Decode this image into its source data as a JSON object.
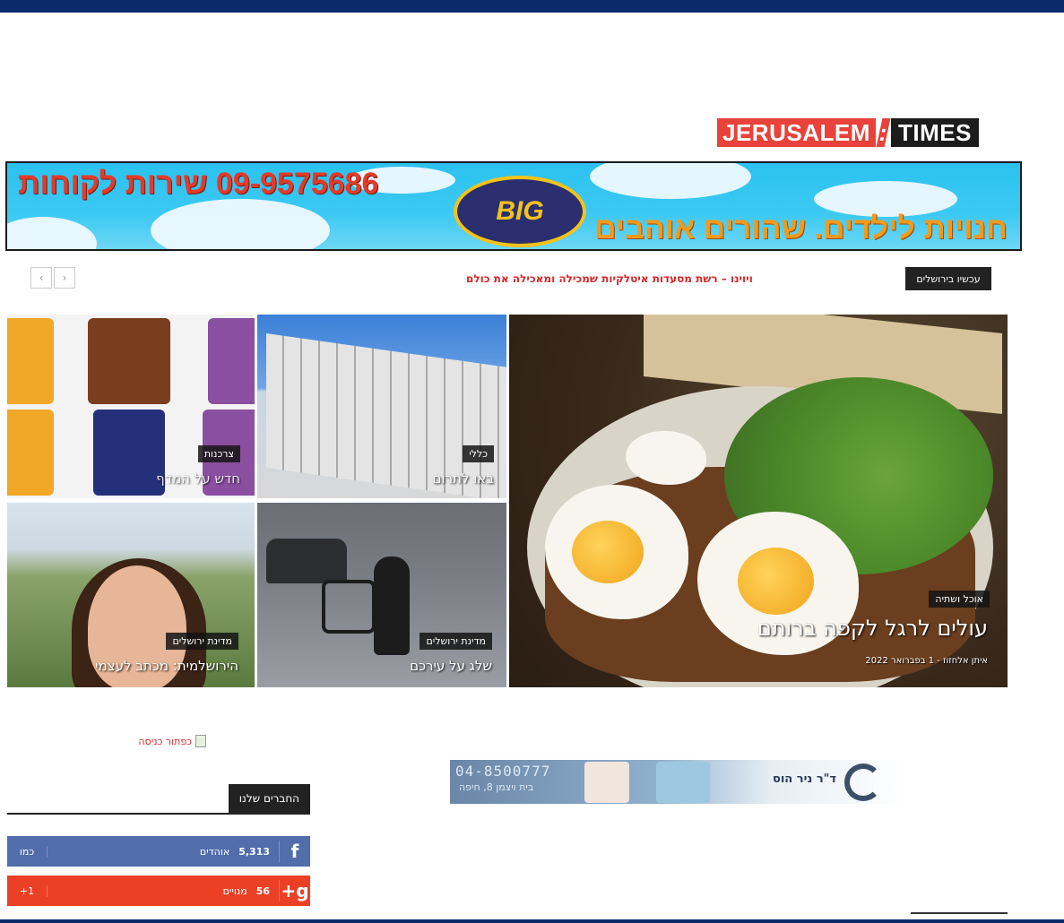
{
  "logo": {
    "part1": "JERUSALEM",
    "separator": ":",
    "part2": "TIMES"
  },
  "banner": {
    "phone_text": "09-9575686 שירות לקוחות",
    "slogan": "חנויות לילדים. שהורים אוהבים",
    "brand": "BIG"
  },
  "ticker": {
    "label": "עכשיו בירושלים",
    "headline": "ויוינו – רשת מסעדות איטלקיות שמכילה ומאכילה את כולם",
    "prev_icon": "chevron-left-icon",
    "next_icon": "chevron-right-icon"
  },
  "tiles": {
    "featured": {
      "category": "אוכל ושתיה",
      "title": "עולים לרגל לקפה ברותם",
      "meta": "איתן אלחזוז - 1 בפברואר 2022"
    },
    "building": {
      "category": "כללי",
      "title": "באו לתרום"
    },
    "snacks": {
      "category": "צרכנות",
      "title": "חדש על המדף"
    },
    "snow": {
      "category": "מדינת ירושלים",
      "title": "שלג על עירכם"
    },
    "woman": {
      "category": "מדינת ירושלים",
      "title": "הירושלמית: מכתב לעצמי"
    }
  },
  "image_placeholder": {
    "alt": "כפתור כניסה"
  },
  "ad_doctor": {
    "phone": "04-8500777",
    "address": "בית ויצמן 8, חיפה",
    "name": "ד\"ר ניר הוס"
  },
  "friends": {
    "title": "החברים שלנו"
  },
  "social": {
    "facebook": {
      "icon": "f",
      "count": "5,313",
      "unit": "אוהדים",
      "action": "כמו"
    },
    "googleplus": {
      "icon": "g+",
      "count": "56",
      "unit": "מנויים",
      "action": "1+"
    }
  },
  "colors": {
    "navy": "#0a2a6a",
    "red": "#e8423a",
    "facebook": "#516eab",
    "googleplus": "#eb4026"
  }
}
